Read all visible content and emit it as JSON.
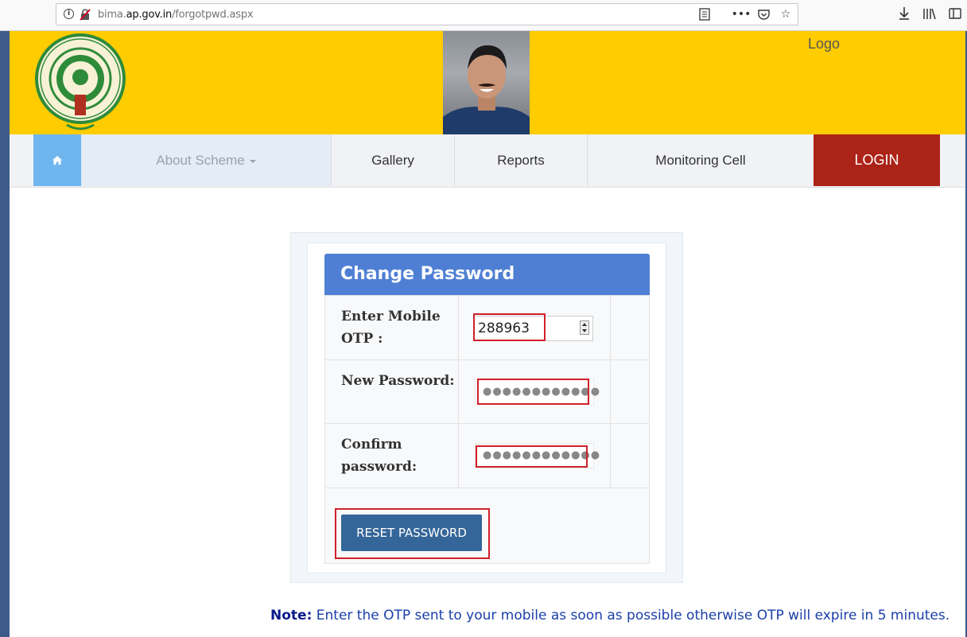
{
  "browser": {
    "url_prefix": "bima.",
    "url_host": "ap.gov.in",
    "url_path": "/forgotpwd.aspx"
  },
  "header": {
    "logo_text": "Logo",
    "emblem_name": "Government of Andhra Pradesh emblem",
    "emblem_text": "GOVERNMENT OF ANDHRA PRADESH"
  },
  "nav": {
    "about": "About Scheme",
    "gallery": "Gallery",
    "reports": "Reports",
    "monitoring": "Monitoring Cell",
    "login": "LOGIN"
  },
  "form": {
    "title": "Change Password",
    "otp_label": "Enter Mobile OTP :",
    "otp_value": "288963",
    "new_password_label": "New Password:",
    "new_password_value": "●●●●●●●●●●●●",
    "confirm_password_label": "Confirm password:",
    "confirm_password_value": "●●●●●●●●●●●●",
    "reset_button": "RESET PASSWORD"
  },
  "note": {
    "label": "Note:",
    "text": " Enter the OTP sent to your mobile as soon as possible otherwise OTP will expire in 5 minutes."
  },
  "colors": {
    "header_bg": "#ffcc00",
    "home_bg": "#6fb6ef",
    "login_bg": "#ac2318",
    "card_head_bg": "#4f7fd4",
    "button_bg": "#356699",
    "highlight": "#d0202a"
  }
}
